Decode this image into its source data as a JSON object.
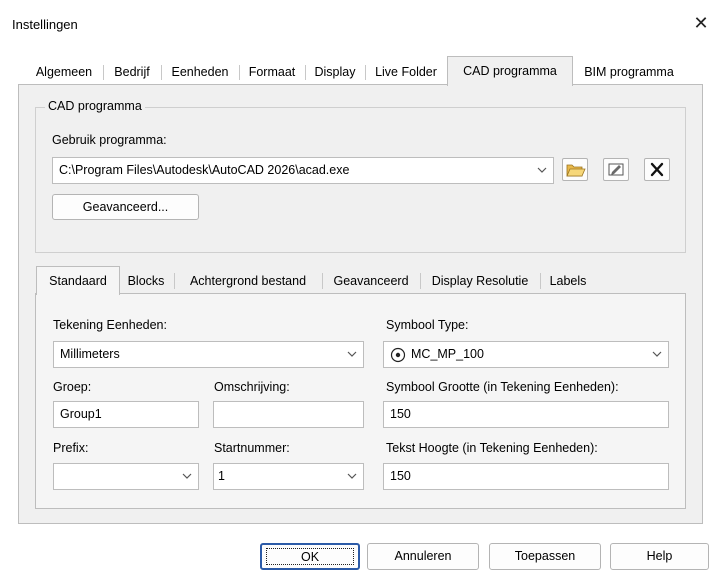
{
  "window": {
    "title": "Instellingen",
    "close_glyph": "✕"
  },
  "tabs": [
    {
      "label": "Algemeen"
    },
    {
      "label": "Bedrijf"
    },
    {
      "label": "Eenheden"
    },
    {
      "label": "Formaat"
    },
    {
      "label": "Display"
    },
    {
      "label": "Live Folder"
    },
    {
      "label": "CAD programma",
      "active": true
    },
    {
      "label": "BIM programma"
    }
  ],
  "cad_group": {
    "legend": "CAD programma",
    "program_label": "Gebruik programma:",
    "program_value": "C:\\Program Files\\Autodesk\\AutoCAD 2026\\acad.exe",
    "icons": [
      "folder-open-icon",
      "edit-icon",
      "delete-x-icon"
    ],
    "advanced_button": "Geavanceerd..."
  },
  "inner_tabs": [
    {
      "label": "Standaard",
      "active": true
    },
    {
      "label": "Blocks"
    },
    {
      "label": "Achtergrond bestand"
    },
    {
      "label": "Geavanceerd"
    },
    {
      "label": "Display Resolutie"
    },
    {
      "label": "Labels"
    }
  ],
  "standaard": {
    "drawing_units_label": "Tekening Eenheden:",
    "drawing_units_value": "Millimeters",
    "group_label": "Groep:",
    "group_value": "Group1",
    "description_label": "Omschrijving:",
    "description_value": "",
    "prefix_label": "Prefix:",
    "prefix_value": "",
    "start_number_label": "Startnummer:",
    "start_number_value": "1",
    "symbol_type_label": "Symbool Type:",
    "symbol_type_value": "MC_MP_100",
    "symbol_size_label": "Symbool Grootte (in Tekening Eenheden):",
    "symbol_size_value": "150",
    "text_height_label": "Tekst Hoogte (in Tekening Eenheden):",
    "text_height_value": "150"
  },
  "buttons": {
    "ok": "OK",
    "cancel": "Annuleren",
    "apply": "Toepassen",
    "help": "Help"
  }
}
